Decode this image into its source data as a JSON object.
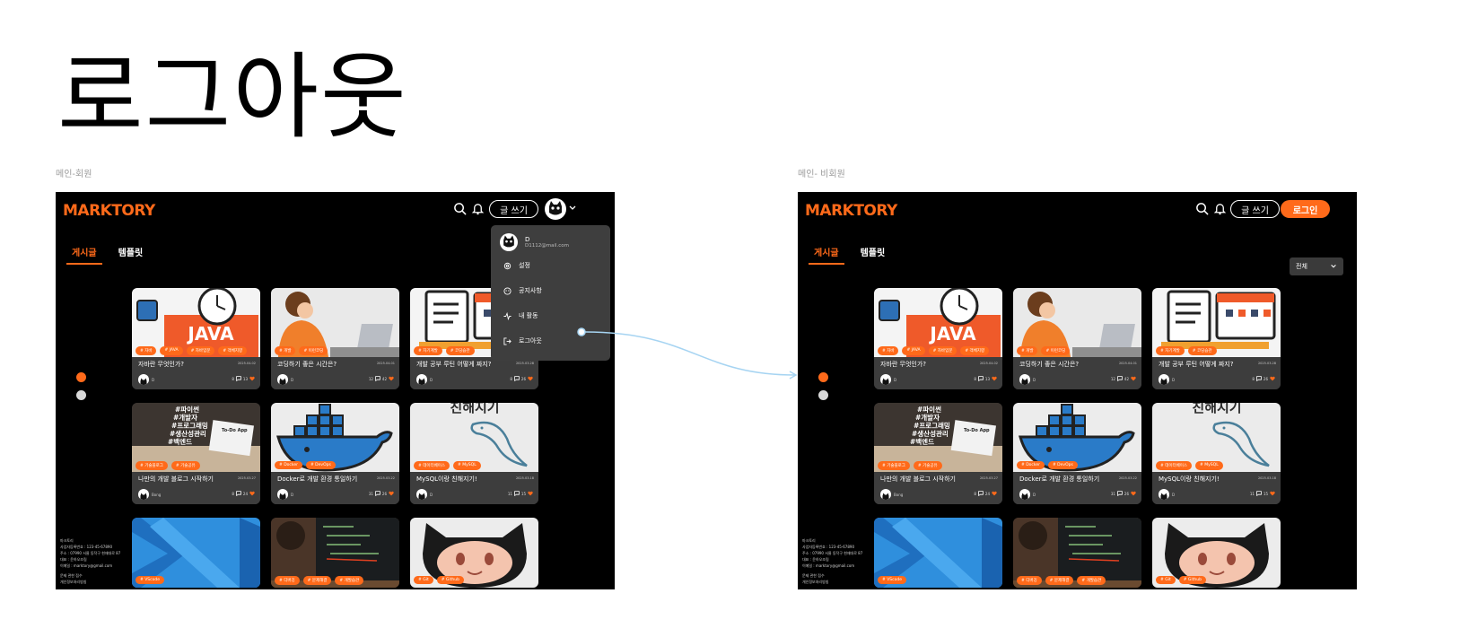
{
  "page": {
    "title": "로그아웃",
    "accent_color": "#ff6a1a",
    "connector_color": "#a6d4f2"
  },
  "frames": [
    {
      "label": "메인-회원",
      "logo": "MARKTORY",
      "write_label": "글 쓰기",
      "tabs": [
        "게시글",
        "템플릿"
      ],
      "dropdown": {
        "name": "D",
        "email": "D1112@mail.com",
        "items": [
          "설정",
          "공지사항",
          "내 활동",
          "로그아웃"
        ]
      }
    },
    {
      "label": "메인- 비회원",
      "logo": "MARKTORY",
      "write_label": "글 쓰기",
      "login_label": "로그인",
      "tabs": [
        "게시글",
        "템플릿"
      ],
      "sort_select": "전체"
    }
  ],
  "footer_lines": [
    "마크토리",
    "사업자등록번호 : 123-45-67890",
    "주소 : 07990 서울 동작구 현재대로 87",
    "대표 : 윤하오조림",
    "이메일 : marktory@gmail.com",
    "",
    "문제 관한 접수",
    "개인정보처리방침"
  ],
  "cards": [
    {
      "title": "자바란 무엇인가?",
      "date": "2025.04.02",
      "author": "D",
      "comments": "8",
      "likes": "13",
      "tags": [
        "자바",
        "JAVA",
        "자바입문",
        "객체지향"
      ],
      "thumb": "java"
    },
    {
      "title": "코딩하기 좋은 시간은?",
      "date": "2025.04.01",
      "author": "D",
      "comments": "12",
      "likes": "42",
      "tags": [
        "개발",
        "이런코딩"
      ],
      "thumb": "coding"
    },
    {
      "title": "개발 공부 루틴 어떻게 짜지?",
      "date": "2025.03.28",
      "author": "D",
      "comments": "8",
      "likes": "26",
      "tags": [
        "자기계발",
        "코딩습관"
      ],
      "thumb": "routine"
    },
    {
      "title": "나만의 개발 블로그 시작하기",
      "date": "2025.03.27",
      "author": "Bong",
      "comments": "8",
      "likes": "24",
      "tags": [
        "기술블로그",
        "기술공유"
      ],
      "thumb": "blog"
    },
    {
      "title": "Docker로 개발 환경 통일하기",
      "date": "2025.03.22",
      "author": "D",
      "comments": "31",
      "likes": "26",
      "tags": [
        "Docker",
        "DevOps"
      ],
      "thumb": "docker"
    },
    {
      "title": "MySQL이랑 친해지기!",
      "date": "2025.03.18",
      "author": "D",
      "comments": "11",
      "likes": "15",
      "tags": [
        "데이터베이스",
        "MySQL"
      ],
      "thumb": "mysql"
    },
    {
      "title": "",
      "date": "",
      "author": "",
      "comments": "",
      "likes": "",
      "tags": [
        "VScode"
      ],
      "thumb": "vscode"
    },
    {
      "title": "",
      "date": "",
      "author": "",
      "comments": "",
      "likes": "",
      "tags": [
        "디버깅",
        "문제해결",
        "개발습관"
      ],
      "thumb": "debug"
    },
    {
      "title": "",
      "date": "",
      "author": "",
      "comments": "",
      "likes": "",
      "tags": [
        "Git",
        "Github"
      ],
      "thumb": "github"
    }
  ],
  "thumb_text": {
    "java": "JAVA",
    "blog_lines": [
      "#파이썬",
      "#개발자",
      "#프로그래밍",
      "#생산성관리",
      "#백엔드"
    ],
    "blog_app": "To-Do App",
    "mysql": "친해지기"
  }
}
